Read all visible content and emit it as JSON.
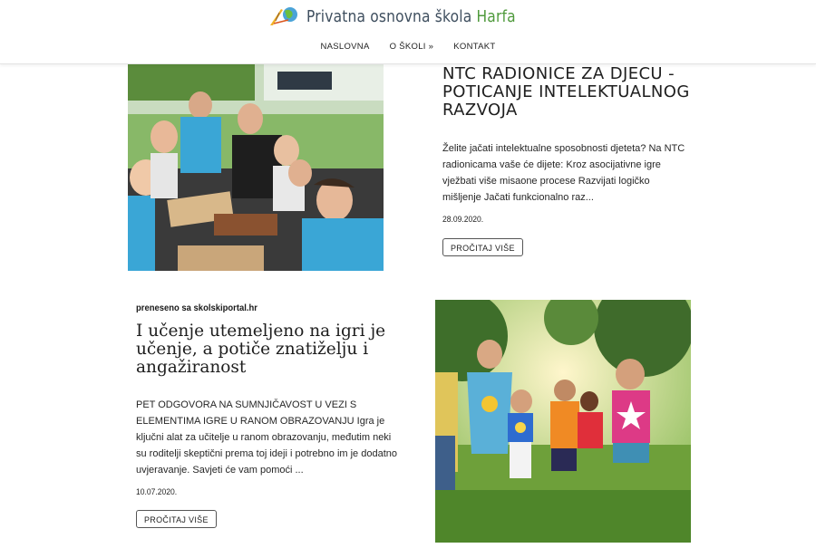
{
  "header": {
    "brand_main": "Privatna osnovna škola ",
    "brand_accent": "Harfa",
    "logo_icon": "harp-globe-logo",
    "nav": [
      {
        "label": "NASLOVNA"
      },
      {
        "label": "O ŠKOLI »"
      },
      {
        "label": "KONTAKT"
      }
    ]
  },
  "posts": [
    {
      "title": "NTC RADIONICE ZA DJECU - POTICANJE INTELEKTUALNOG RAZVOJA",
      "excerpt": "  Želite jačati intelektualne sposobnosti djeteta?   Na NTC radionicama vaše će dijete: Kroz asocijativne igre vježbati više misaone procese Razvijati logičko mišljenje Jačati funkcionalno raz...",
      "date": "28.09.2020.",
      "read_more": "PROČITAJ VIŠE",
      "image_icon": "family-playing-chess-photo"
    },
    {
      "source": "preneseno sa skolskiportal.hr",
      "title": "I učenje utemeljeno na igri je učenje, a potiče znatiželju i angažiranost",
      "excerpt": "PET ODGOVORA NA SUMNJIČAVOST U VEZI S ELEMENTIMA IGRE U RANOM OBRAZOVANJU Igra je ključni alat za učitelje u ranom obrazovanju, međutim neki su roditelji skeptični prema toj ideji i potrebno im je dodatno uvjeravanje. Savjeti će vam pomoći ...",
      "date": "10.07.2020.",
      "read_more": "PROČITAJ VIŠE",
      "image_icon": "children-running-in-park-photo"
    }
  ],
  "colors": {
    "brand_text": "#3f4f5f",
    "brand_accent": "#4f9a3c",
    "header_border": "#e4e4e4"
  }
}
